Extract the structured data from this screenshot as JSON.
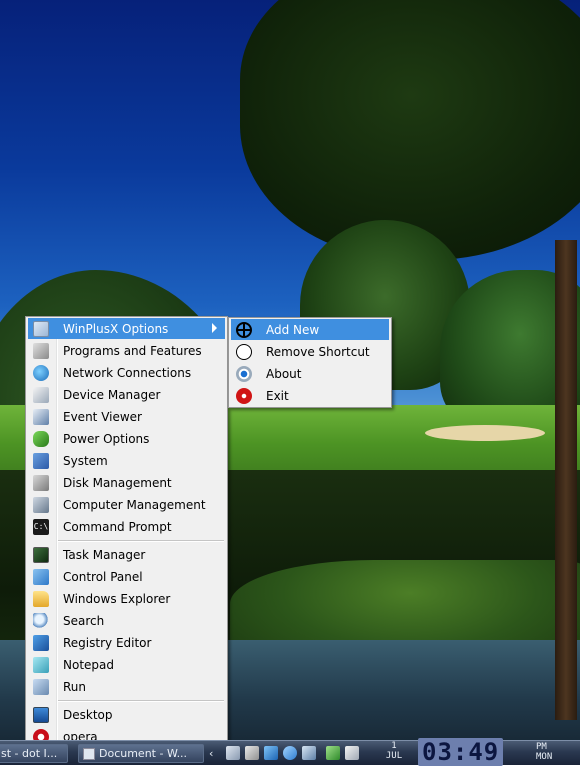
{
  "menu": {
    "items": [
      {
        "label": "WinPlusX Options",
        "icon": "winplusx-options-icon"
      },
      {
        "label": "Programs and Features",
        "icon": "programs-features-icon"
      },
      {
        "label": "Network Connections",
        "icon": "network-icon"
      },
      {
        "label": "Device Manager",
        "icon": "device-manager-icon"
      },
      {
        "label": "Event Viewer",
        "icon": "event-viewer-icon"
      },
      {
        "label": "Power Options",
        "icon": "power-icon"
      },
      {
        "label": "System",
        "icon": "system-icon"
      },
      {
        "label": "Disk Management",
        "icon": "disk-icon"
      },
      {
        "label": "Computer Management",
        "icon": "computer-management-icon"
      },
      {
        "label": "Command Prompt",
        "icon": "command-prompt-icon",
        "icon_text": "C:\\"
      },
      {
        "label": "Task Manager",
        "icon": "task-manager-icon"
      },
      {
        "label": "Control Panel",
        "icon": "control-panel-icon"
      },
      {
        "label": "Windows Explorer",
        "icon": "explorer-icon"
      },
      {
        "label": "Search",
        "icon": "search-icon"
      },
      {
        "label": "Registry Editor",
        "icon": "registry-icon"
      },
      {
        "label": "Notepad",
        "icon": "notepad-icon"
      },
      {
        "label": "Run",
        "icon": "run-icon"
      },
      {
        "label": "Desktop",
        "icon": "desktop-icon"
      },
      {
        "label": "opera",
        "icon": "opera-icon"
      }
    ]
  },
  "submenu": {
    "items": [
      {
        "label": "Add New",
        "icon": "add-icon"
      },
      {
        "label": "Remove Shortcut",
        "icon": "remove-icon"
      },
      {
        "label": "About",
        "icon": "about-icon"
      },
      {
        "label": "Exit",
        "icon": "exit-icon"
      }
    ]
  },
  "taskbar": {
    "task1": "st - dot I...",
    "task2": "Document - W...",
    "tray_arrow": "‹",
    "date_day": "1",
    "date_month": "JUL",
    "time": "03:49",
    "ampm": "PM",
    "weekday": "MON"
  },
  "colors": {
    "highlight": "#3f8fe0",
    "menu_bg": "#f0f0f0",
    "clock_bg": "#6d7fae"
  }
}
